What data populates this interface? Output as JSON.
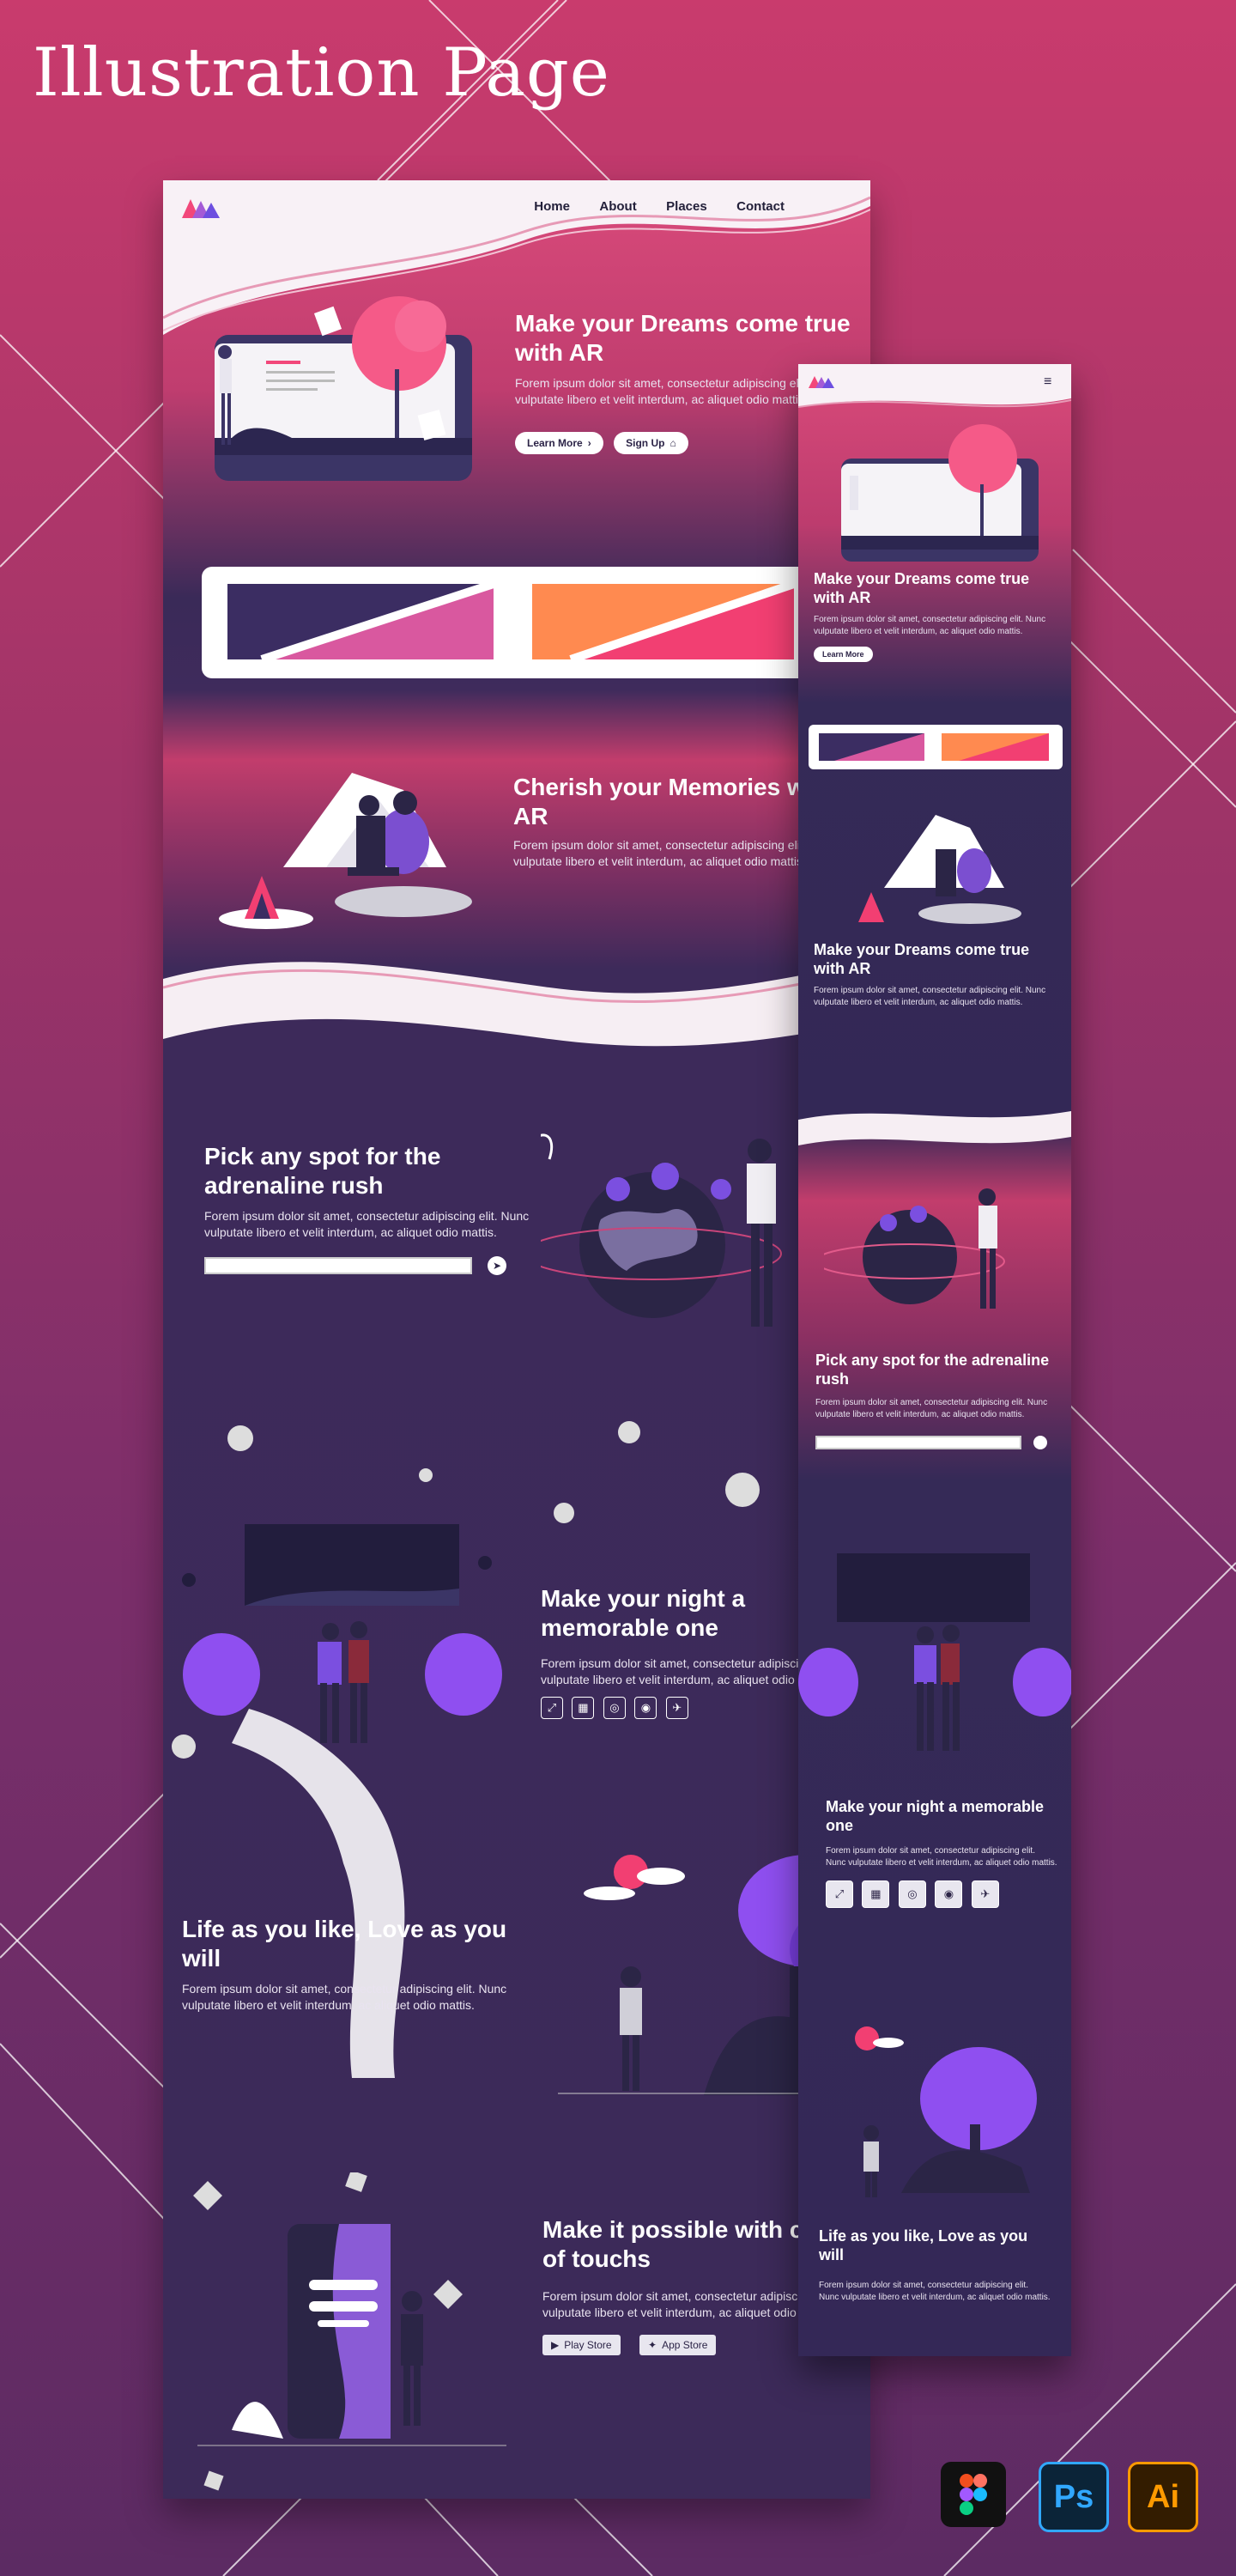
{
  "showcase": {
    "title": "Illustration Page"
  },
  "desktop": {
    "nav": [
      "Home",
      "About",
      "Places",
      "Contact"
    ],
    "hero": {
      "title": "Make your Dreams come true with AR",
      "text": "Forem ipsum dolor sit amet, consectetur adipiscing elit. Nunc vulputate libero et velit interdum, ac aliquet odio mattis.",
      "learn_more": "Learn More",
      "sign_up": "Sign Up"
    },
    "cherish": {
      "title": "Cherish your Memories with AR",
      "text": "Forem ipsum dolor sit amet, consectetur adipiscing elit. Nunc vulputate libero et velit interdum, ac aliquet odio mattis."
    },
    "spot": {
      "title": "Pick any spot for the adrenaline rush",
      "text": "Forem ipsum dolor sit amet, consectetur adipiscing elit. Nunc vulputate libero et velit interdum, ac aliquet odio mattis."
    },
    "night": {
      "title": "Make your night a memorable one",
      "text": "Forem ipsum dolor sit amet, consectetur adipiscing elit. Nunc vulputate libero et velit interdum, ac aliquet odio mattis."
    },
    "life": {
      "title": "Life as you like, Love as you will",
      "text": "Forem ipsum dolor sit amet, consectetur adipiscing elit. Nunc vulputate libero et velit interdum, ac aliquet odio mattis."
    },
    "touch": {
      "title": "Make it possible with couple of touchs",
      "text": "Forem ipsum dolor sit amet, consectetur adipiscing elit. Nunc vulputate libero et velit interdum, ac aliquet odio mattis.",
      "play_store": "Play Store",
      "app_store": "App Store"
    }
  },
  "mobile": {
    "hero": {
      "title": "Make your Dreams come true with AR",
      "text": "Forem ipsum dolor sit amet, consectetur adipiscing elit. Nunc vulputate libero et velit interdum, ac aliquet odio mattis.",
      "learn_more": "Learn More"
    },
    "dreams2": {
      "title": "Make your Dreams come true with AR",
      "text": "Forem ipsum dolor sit amet, consectetur adipiscing elit. Nunc vulputate libero et velit interdum, ac aliquet odio mattis."
    },
    "spot": {
      "title": "Pick any spot for the adrenaline rush",
      "text": "Forem ipsum dolor sit amet, consectetur adipiscing elit. Nunc vulputate libero et velit interdum, ac aliquet odio mattis."
    },
    "night": {
      "title": "Make your night a memorable one",
      "text": "Forem ipsum dolor sit amet, consectetur adipiscing elit. Nunc vulputate libero et velit interdum, ac aliquet odio mattis."
    },
    "life": {
      "title": "Life as you like, Love as you will",
      "text": "Forem ipsum dolor sit amet, consectetur adipiscing elit. Nunc vulputate libero et velit interdum, ac aliquet odio mattis."
    }
  },
  "tools": {
    "ps": "Ps",
    "ai": "Ai"
  },
  "colors": {
    "accent_pink": "#f23f72",
    "accent_purple": "#7b3fe4",
    "deep_purple": "#372a58",
    "orange": "#ff8a50",
    "magenta": "#d9589f"
  }
}
